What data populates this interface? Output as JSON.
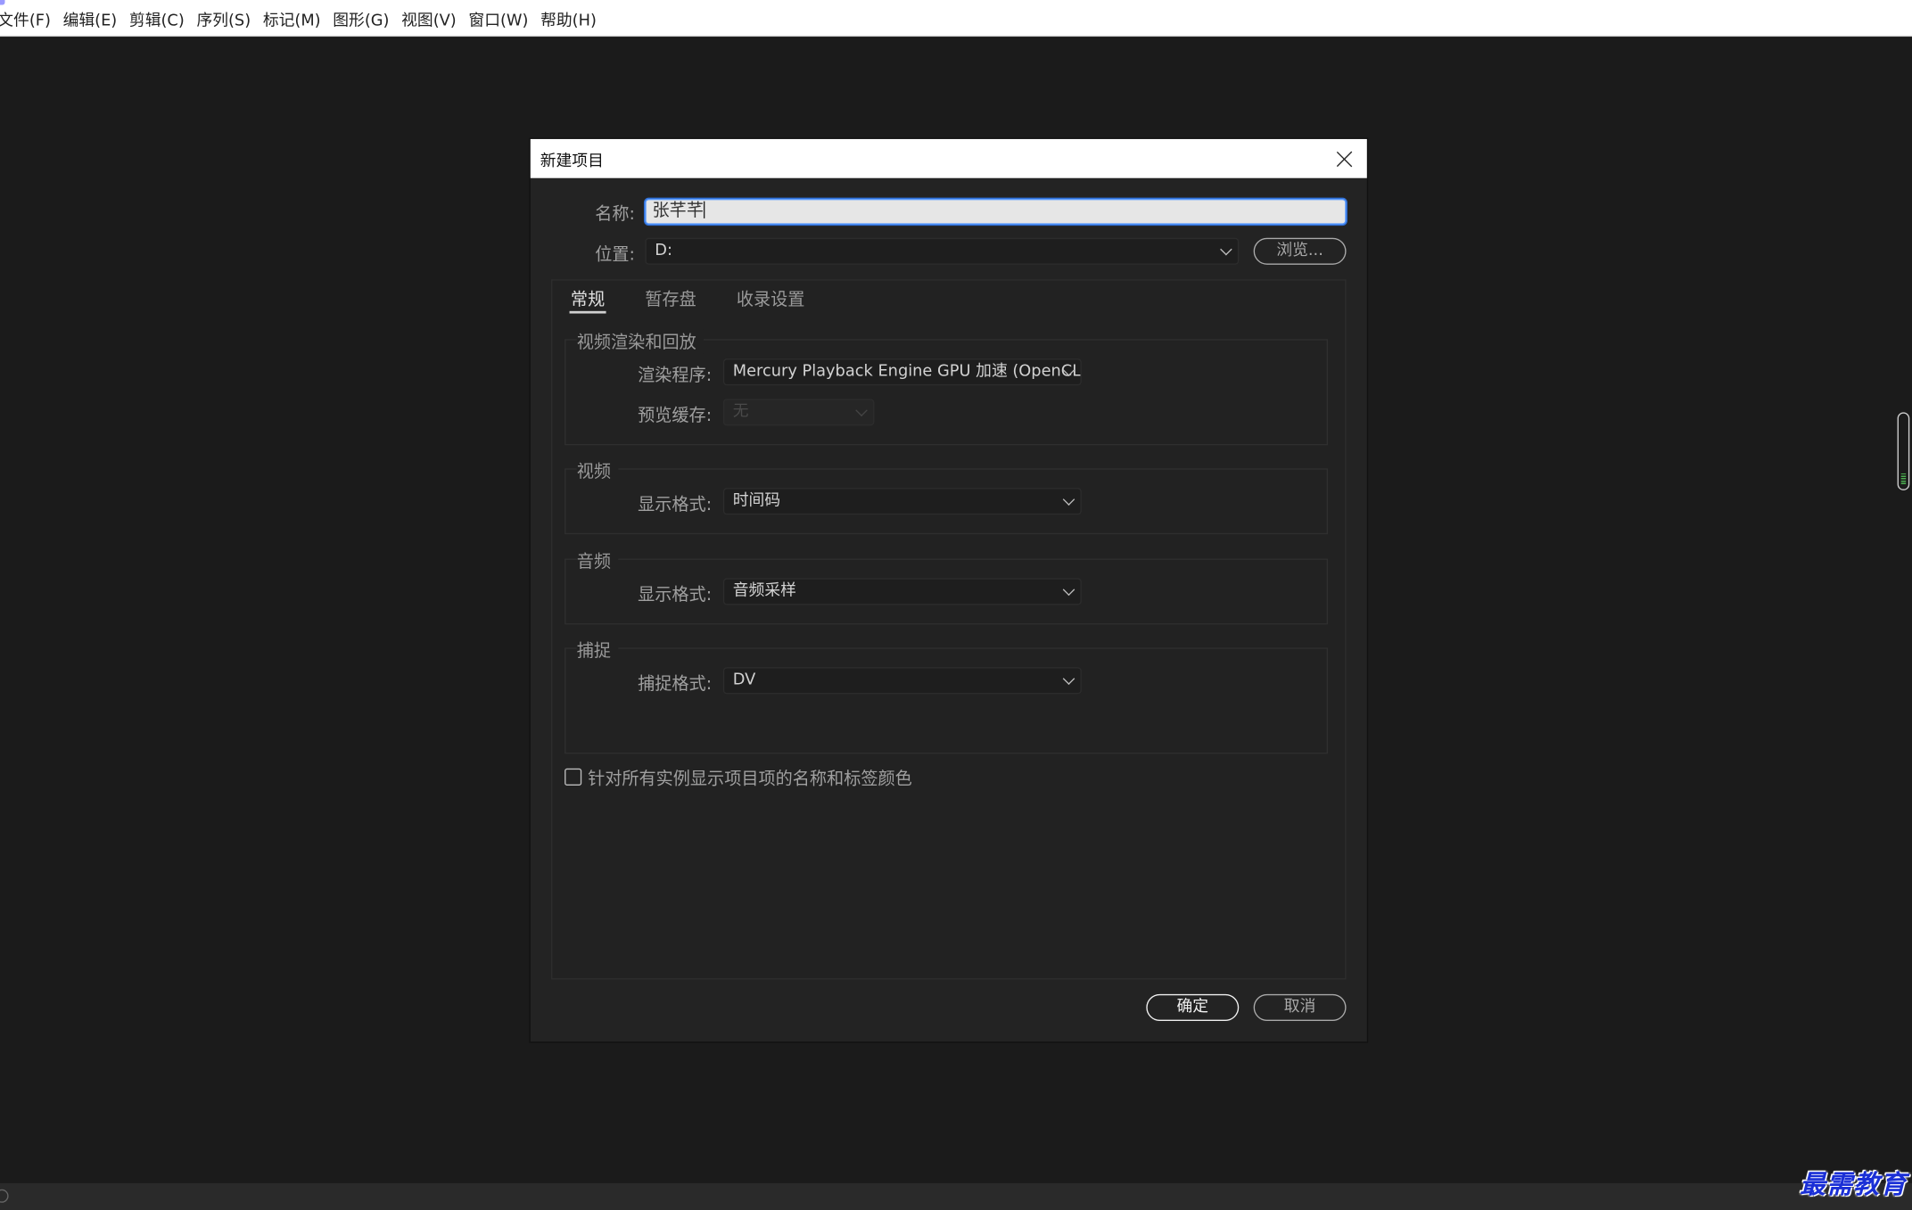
{
  "app": {
    "menu": [
      "文件(F)",
      "编辑(E)",
      "剪辑(C)",
      "序列(S)",
      "标记(M)",
      "图形(G)",
      "视图(V)",
      "窗口(W)",
      "帮助(H)"
    ]
  },
  "dialog": {
    "title": "新建项目",
    "name_label": "名称:",
    "name_value": "张芊芊",
    "location_label": "位置:",
    "location_value": "D:",
    "browse_label": "浏览...",
    "tabs": [
      "常规",
      "暂存盘",
      "收录设置"
    ],
    "active_tab": "常规",
    "video_render": {
      "title": "视频渲染和回放",
      "renderer_label": "渲染程序:",
      "renderer_value": "Mercury Playback Engine GPU 加速 (OpenCL)",
      "preview_cache_label": "预览缓存:",
      "preview_cache_value": "无"
    },
    "video": {
      "title": "视频",
      "display_format_label": "显示格式:",
      "display_format_value": "时间码"
    },
    "audio": {
      "title": "音频",
      "display_format_label": "显示格式:",
      "display_format_value": "音频采样"
    },
    "capture": {
      "title": "捕捉",
      "capture_format_label": "捕捉格式:",
      "capture_format_value": "DV"
    },
    "checkbox_label": "针对所有实例显示项目项的名称和标签颜色",
    "checkbox_checked": false,
    "ok_label": "确定",
    "cancel_label": "取消"
  },
  "watermark": "最需教育"
}
